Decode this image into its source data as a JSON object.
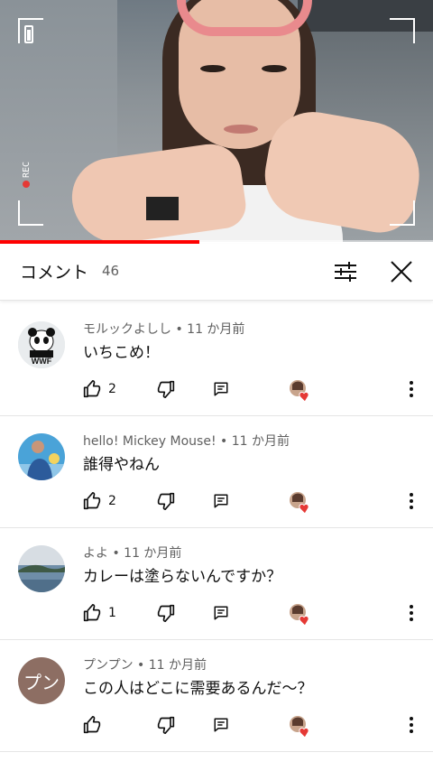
{
  "video": {
    "progress_percent": 46,
    "icons": [
      "battery-icon",
      "rec-indicator"
    ]
  },
  "comments_panel": {
    "title": "コメント",
    "count": "46",
    "icons": [
      "filter-sort-icon",
      "close-icon"
    ]
  },
  "comments": [
    {
      "author_meta": "モルックよしし • 11 か月前",
      "text": "いちこめ！",
      "likes": "2",
      "avatar": "panda-logo"
    },
    {
      "author_meta": "hello! Mickey Mouse! • 11 か月前",
      "text": "誰得やねん",
      "likes": "2",
      "avatar": "photo-person"
    },
    {
      "author_meta": "よよ • 11 か月前",
      "text": "カレーは塗らないんですか？",
      "likes": "1",
      "avatar": "photo-sea"
    },
    {
      "author_meta": "プンプン • 11 か月前",
      "text": "この人はどこに需要あるんだ～？",
      "likes": "",
      "avatar_text": "プン",
      "avatar_color": "#8d6e63"
    }
  ],
  "colors": {
    "accent_red": "#ff0000",
    "heart": "#e53935",
    "text_secondary": "#606060"
  }
}
